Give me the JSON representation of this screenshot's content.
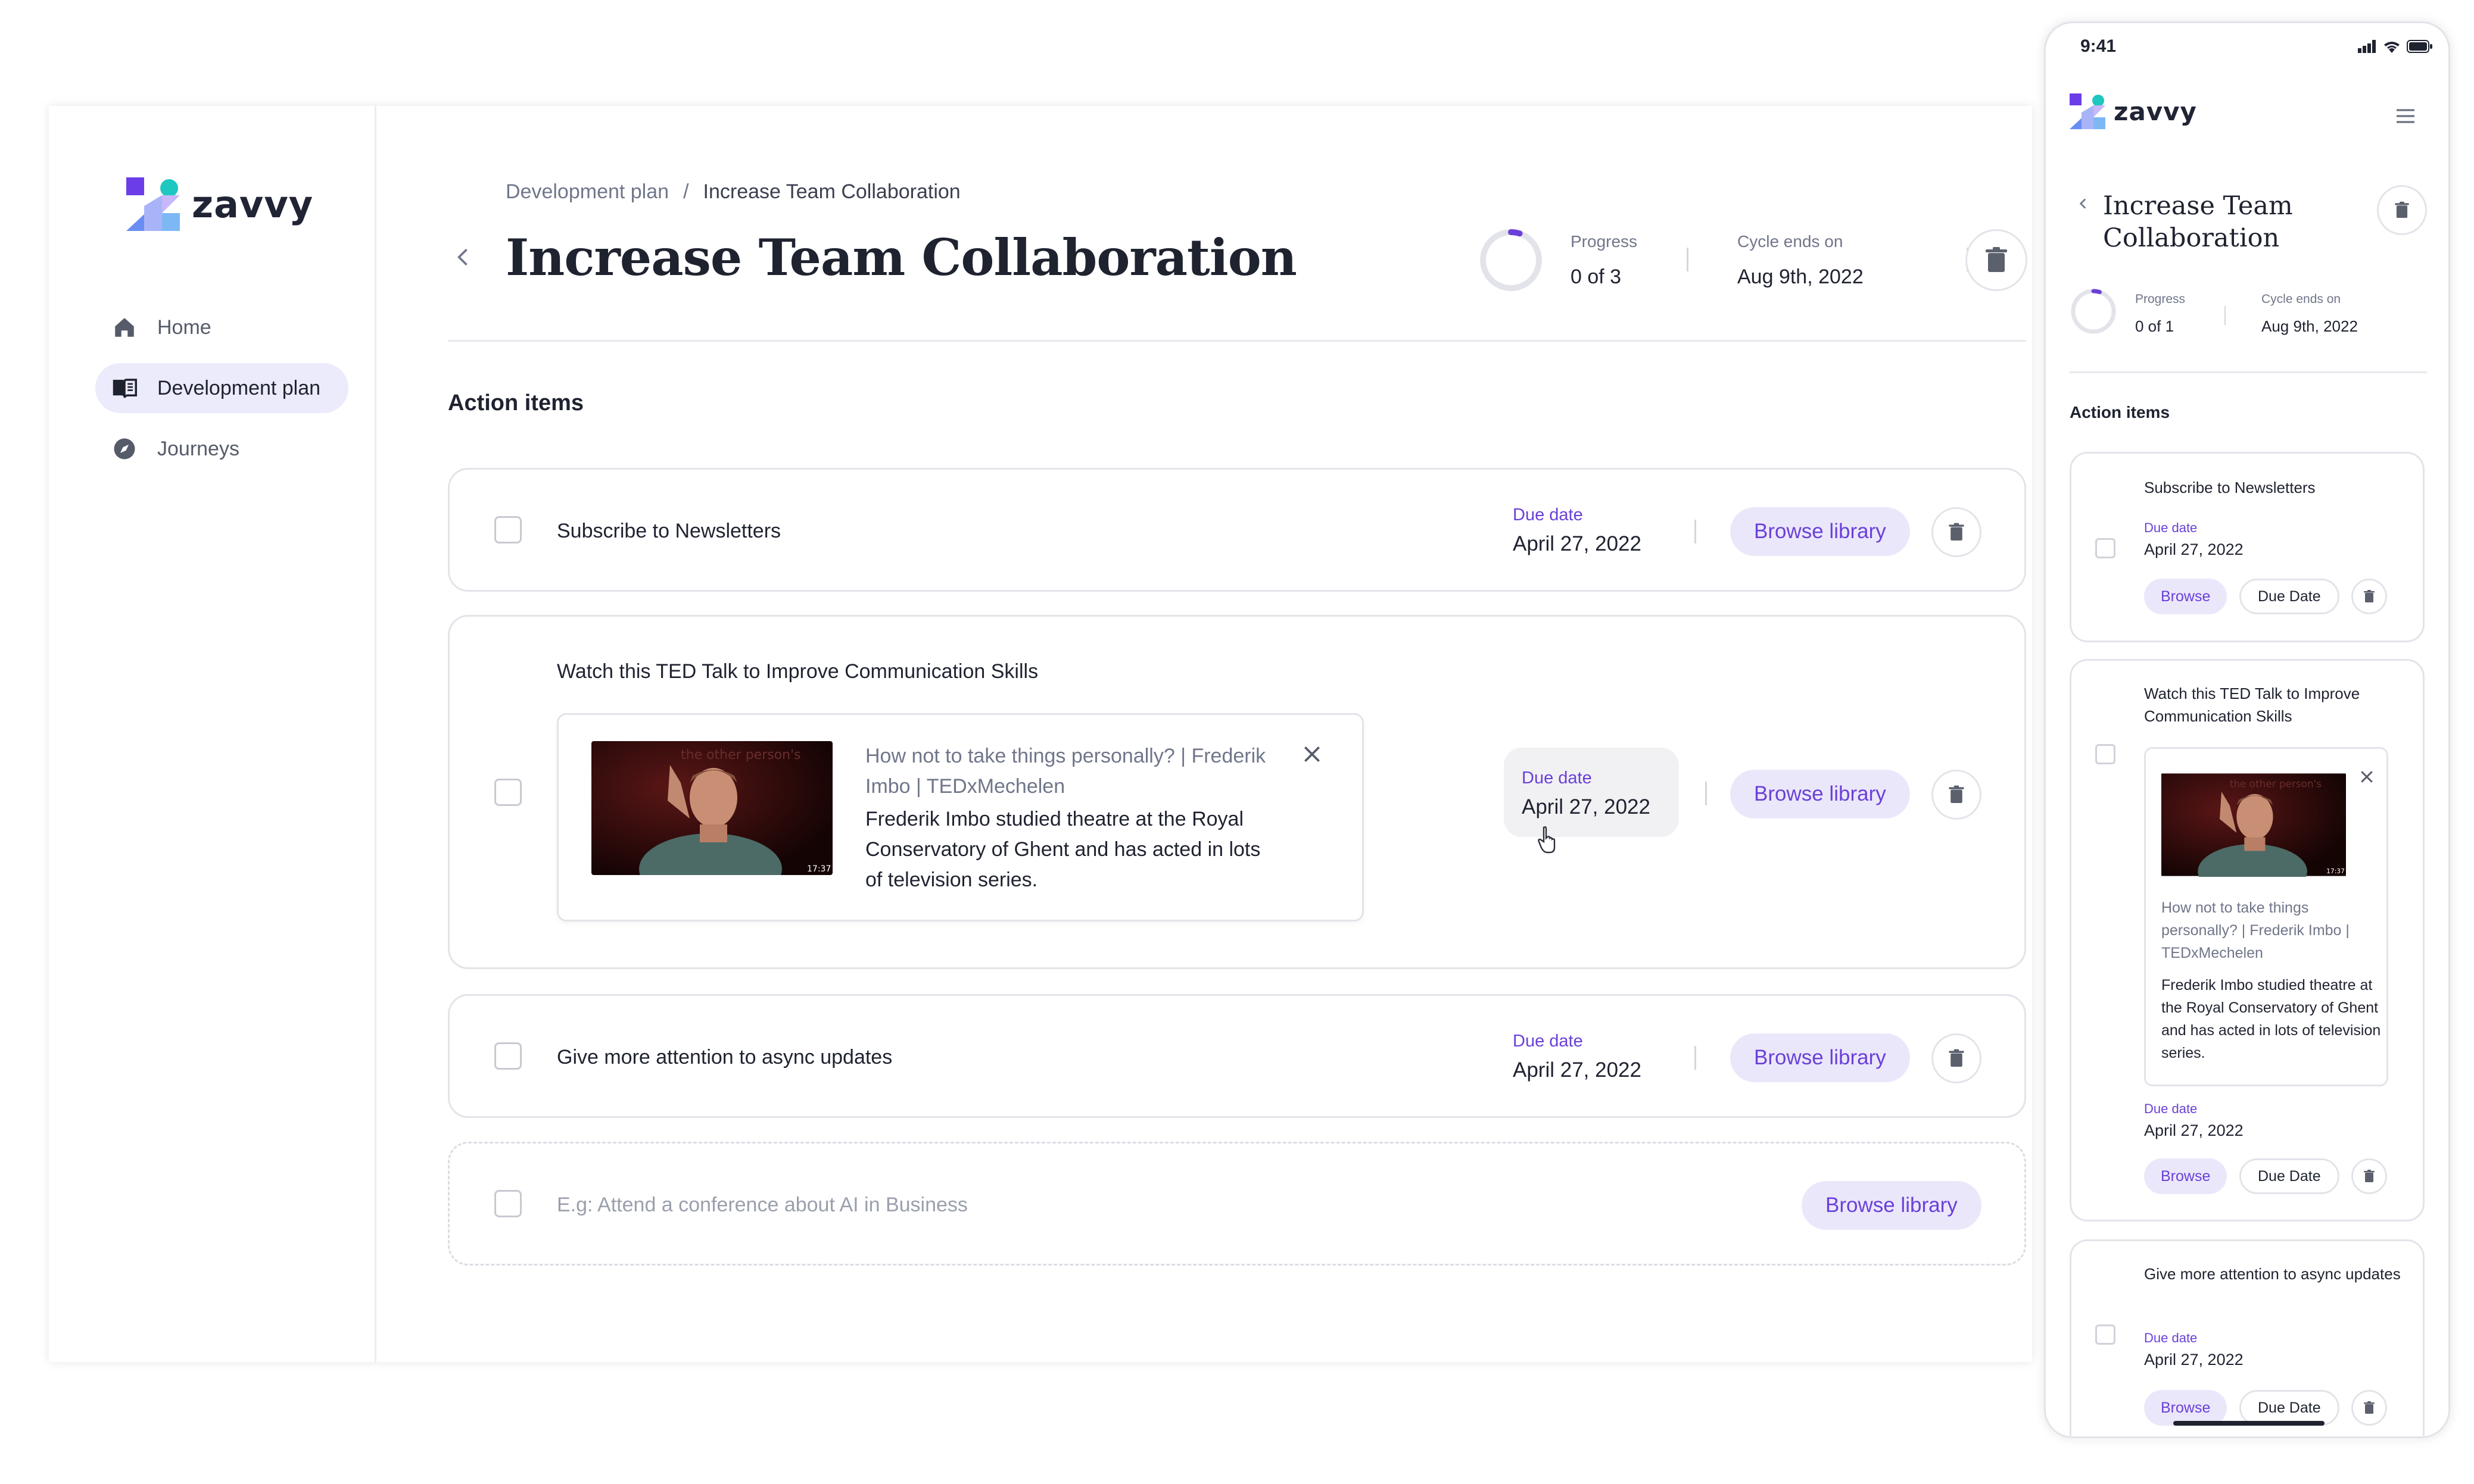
{
  "brand": {
    "name": "zavvy"
  },
  "sidebar": {
    "items": [
      {
        "label": "Home",
        "icon": "home-icon"
      },
      {
        "label": "Development plan",
        "icon": "book-icon"
      },
      {
        "label": "Journeys",
        "icon": "compass-icon"
      }
    ]
  },
  "header": {
    "breadcrumb": {
      "parent": "Development plan",
      "separator": "/",
      "current": "Increase Team Collaboration"
    },
    "title": "Increase Team Collaboration",
    "progress": {
      "label": "Progress",
      "value": "0 of 3",
      "fraction": 0.05
    },
    "cycle": {
      "label": "Cycle ends on",
      "value": "Aug 9th, 2022"
    }
  },
  "action_items": {
    "heading": "Action items",
    "items": [
      {
        "title": "Subscribe to Newsletters",
        "due_label": "Due date",
        "due": "April 27, 2022",
        "button": "Browse library"
      },
      {
        "title": "Watch this TED Talk to Improve Communication Skills",
        "due_label": "Due date",
        "due": "April 27, 2022",
        "button": "Browse library",
        "video": {
          "title": "How not to take things personally? | Frederik Imbo | TEDxMechelen",
          "description": "Frederik Imbo studied theatre at the Royal Conservatory of Ghent and has acted in lots of television series.",
          "duration": "17:37",
          "overlay_text": "the other person's"
        }
      },
      {
        "title": "Give more attention to async updates",
        "due_label": "Due date",
        "due": "April 27, 2022",
        "button": "Browse library"
      }
    ],
    "new_item": {
      "placeholder": "E.g: Attend a conference about AI in Business",
      "button": "Browse library"
    }
  },
  "mobile": {
    "time": "9:41",
    "title": "Increase Team Collaboration",
    "progress": {
      "label": "Progress",
      "value": "0 of 1",
      "fraction": 0.05
    },
    "cycle": {
      "label": "Cycle ends on",
      "value": "Aug 9th, 2022"
    },
    "heading": "Action items",
    "browse": "Browse",
    "due_button": "Due Date",
    "items": [
      {
        "title": "Subscribe to Newsletters",
        "due_label": "Due date",
        "due": "April 27, 2022"
      },
      {
        "title": "Watch this TED Talk to Improve Communication Skills",
        "due_label": "Due date",
        "due": "April 27, 2022",
        "video": {
          "title": "How not to take things personally? | Frederik Imbo | TEDxMechelen",
          "description": "Frederik Imbo studied theatre at the Royal Conservatory of Ghent and has acted in lots of television series.",
          "duration": "17:37",
          "overlay_text": "the other person's"
        }
      },
      {
        "title": "Give more attention to async updates",
        "due_label": "Due date",
        "due": "April 27, 2022"
      }
    ]
  },
  "colors": {
    "accent": "#6a40d8",
    "accent_bg": "#ebe7fb",
    "logo_purple": "#6b3de8",
    "logo_teal": "#1fc7c1",
    "logo_blue": "#7d8ff5"
  }
}
